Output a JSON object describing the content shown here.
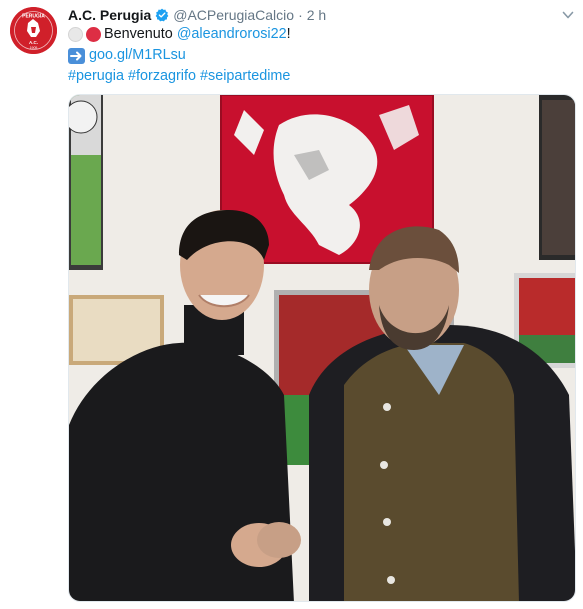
{
  "tweet": {
    "display_name": "A.C. Perugia",
    "handle": "@ACPerugiaCalcio",
    "separator": "·",
    "time": "2 h",
    "line1_prefix": "Benvenuto ",
    "mention": "@aleandrorosi22",
    "line1_suffix": "!",
    "link": "goo.gl/M1RLsu",
    "hashtags": [
      "#perugia",
      "#forzagrifo",
      "#seipartedime"
    ]
  },
  "avatar": {
    "logo_text_top": "PERUGIA",
    "logo_text_bottom": "A.C.",
    "logo_year": "1905"
  },
  "colors": {
    "brand_red": "#d0202a",
    "link_blue": "#1b95e0",
    "verified_blue": "#1da1f2",
    "muted": "#657786"
  },
  "icons": {
    "verified": "verified-badge-icon",
    "caret": "chevron-down-icon",
    "arrow": "right-arrow-emoji-icon",
    "white_circle": "white-circle-emoji-icon",
    "red_circle": "red-circle-emoji-icon"
  }
}
